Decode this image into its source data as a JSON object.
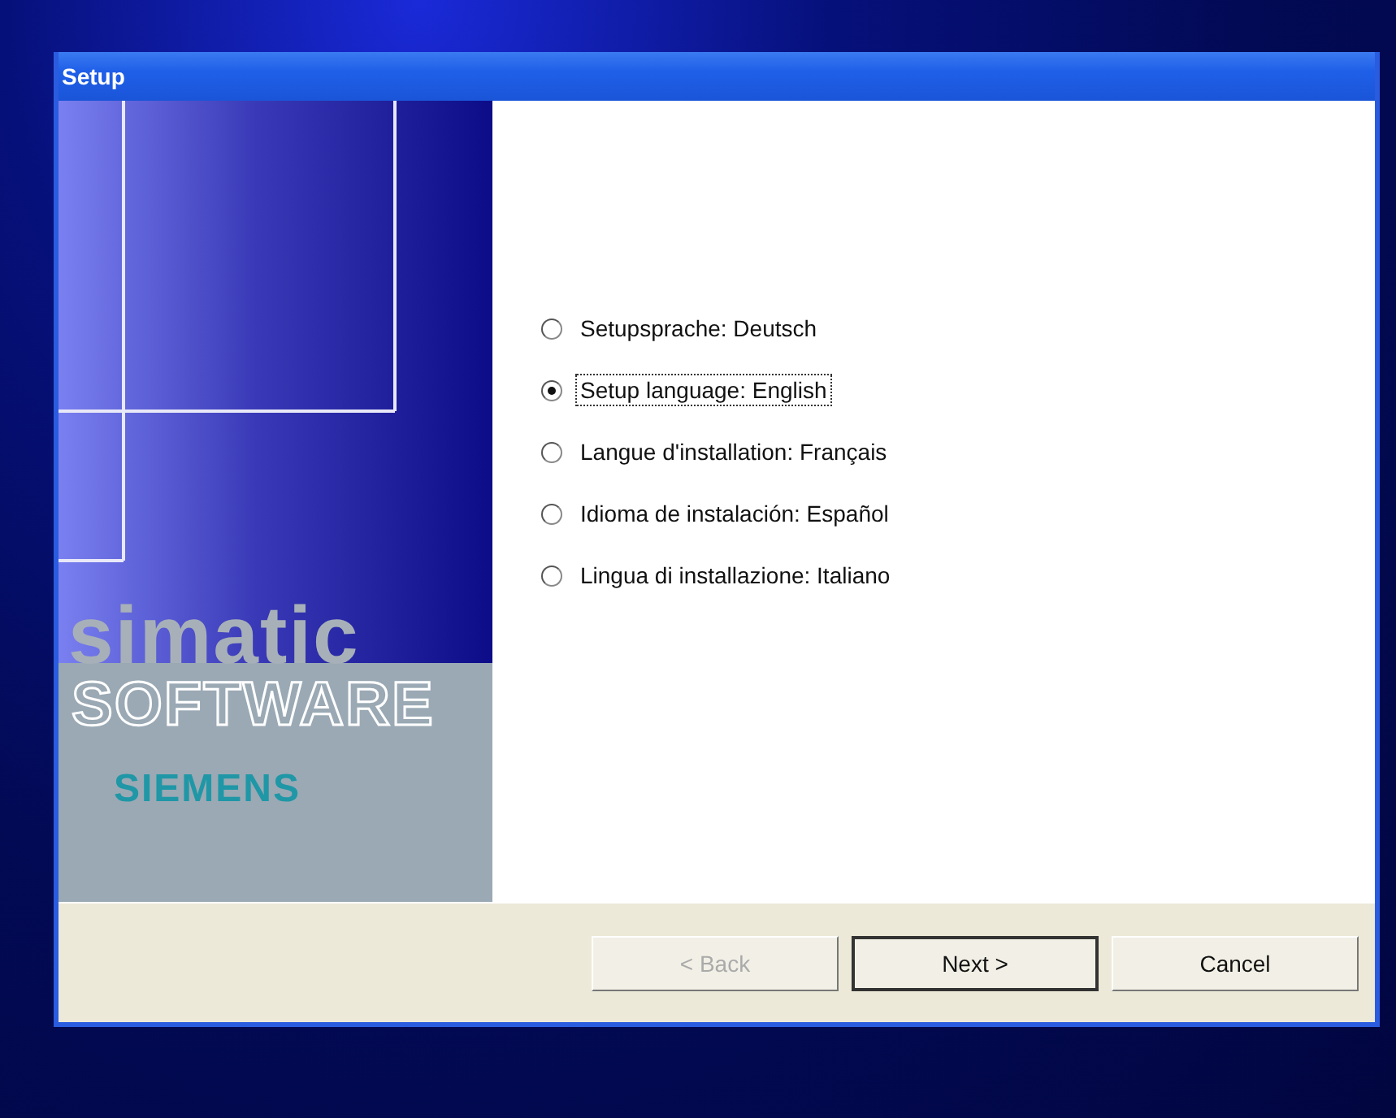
{
  "window": {
    "title": "Setup"
  },
  "sidebar": {
    "brand_line": "simatic",
    "product": "SOFTWARE",
    "company": "SIEMENS"
  },
  "language_options": [
    {
      "label": "Setupsprache: Deutsch",
      "selected": false
    },
    {
      "label": "Setup language: English",
      "selected": true
    },
    {
      "label": "Langue d'installation: Français",
      "selected": false
    },
    {
      "label": "Idioma de instalación: Español",
      "selected": false
    },
    {
      "label": "Lingua di installazione: Italiano",
      "selected": false
    }
  ],
  "buttons": [
    {
      "label": "< Back",
      "disabled": true,
      "default": false
    },
    {
      "label": "Next >",
      "disabled": false,
      "default": true
    },
    {
      "label": "Cancel",
      "disabled": false,
      "default": false
    }
  ]
}
